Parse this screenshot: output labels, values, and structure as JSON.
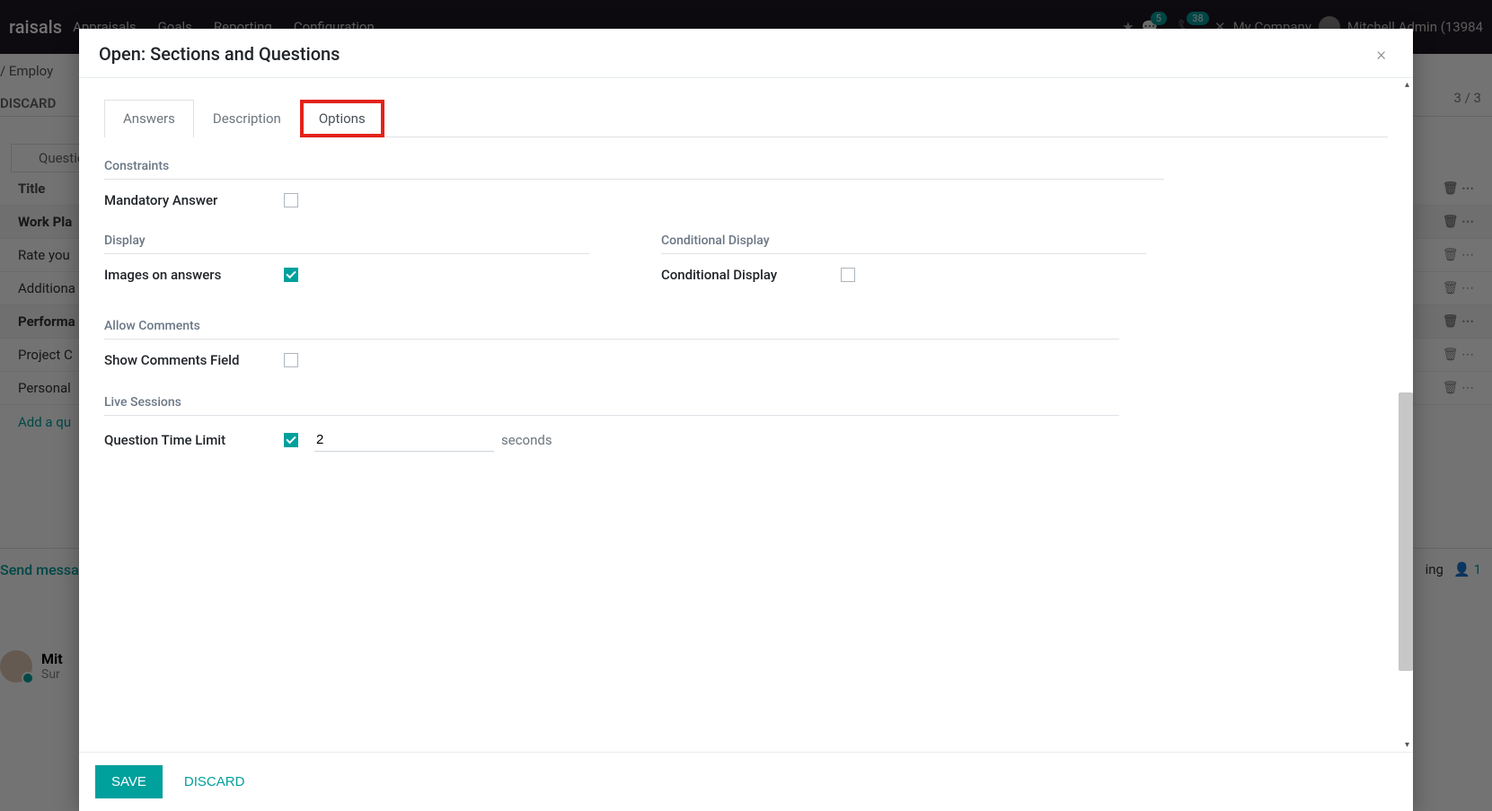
{
  "bg": {
    "app": "raisals",
    "nav": [
      "Appraisals",
      "Goals",
      "Reporting",
      "Configuration"
    ],
    "badges": [
      "5",
      "38"
    ],
    "company": "My Company",
    "user": "Mitchell Admin (13984",
    "breadcrumb": "/ Employ",
    "discard": "DISCARD",
    "pager": "3 / 3",
    "questions_tab": "Questions",
    "title_col": "Title",
    "rows": [
      "Work Pla",
      "Rate you",
      "Additiona",
      "Performa",
      "Project C",
      "Personal"
    ],
    "add": "Add a qu",
    "send": "Send messa",
    "following": "ing",
    "follow_count": "1",
    "msg_name": "Mit",
    "msg_sub": "Sur"
  },
  "modal": {
    "title": "Open: Sections and Questions",
    "tabs": {
      "answers": "Answers",
      "description": "Description",
      "options": "Options"
    },
    "sections": {
      "constraints": "Constraints",
      "display": "Display",
      "conditional": "Conditional Display",
      "comments": "Allow Comments",
      "live": "Live Sessions"
    },
    "labels": {
      "mandatory": "Mandatory Answer",
      "images": "Images on answers",
      "conditional": "Conditional Display",
      "show_comments": "Show Comments Field",
      "time_limit": "Question Time Limit",
      "seconds": "seconds"
    },
    "values": {
      "mandatory": false,
      "images": true,
      "conditional": false,
      "show_comments": false,
      "time_limit_enabled": true,
      "time_limit_value": "2"
    },
    "footer": {
      "save": "SAVE",
      "discard": "DISCARD"
    }
  }
}
